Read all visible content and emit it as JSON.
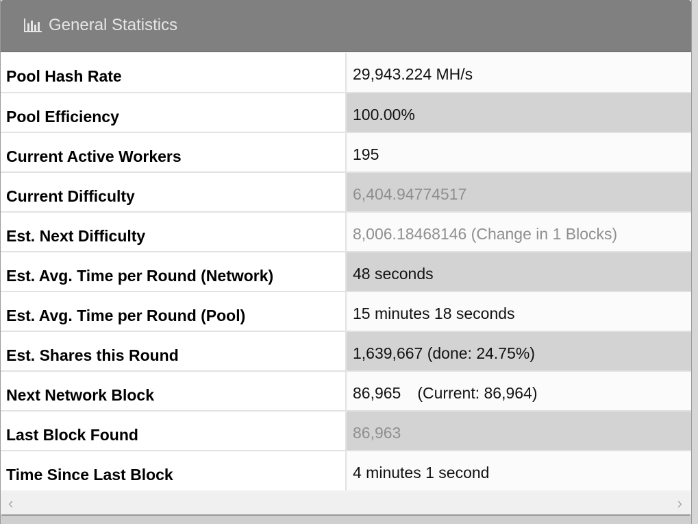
{
  "panel": {
    "title": "General Statistics",
    "icon": "bar-chart-icon"
  },
  "stats": [
    {
      "label": "Pool Hash Rate",
      "value": "29,943.224 MH/s"
    },
    {
      "label": "Pool Efficiency",
      "value": "100.00%"
    },
    {
      "label": "Current Active Workers",
      "value": "195"
    },
    {
      "label": "Current Difficulty",
      "value": "6,404.94774517"
    },
    {
      "label": "Est. Next Difficulty",
      "value": "8,006.18468146 (Change in 1 Blocks)"
    },
    {
      "label": "Est. Avg. Time per Round (Network)",
      "value": "48 seconds"
    },
    {
      "label": "Est. Avg. Time per Round (Pool)",
      "value": "15 minutes 18 seconds"
    },
    {
      "label": "Est. Shares this Round",
      "value": "1,639,667 (done: 24.75%)"
    },
    {
      "label": "Next Network Block",
      "value": "86,965",
      "value_extra": "(Current: 86,964)"
    },
    {
      "label": "Last Block Found",
      "value": "86,963"
    },
    {
      "label": "Time Since Last Block",
      "value": "4 minutes 1 second"
    }
  ],
  "scrollbar": {
    "left_arrow": "‹",
    "right_arrow": "›"
  },
  "colors": {
    "header_bg": "#808080",
    "header_text": "#e6e6e6",
    "row_alt_bg": "#d3d3d3",
    "muted_text": "#8f8f8f"
  }
}
